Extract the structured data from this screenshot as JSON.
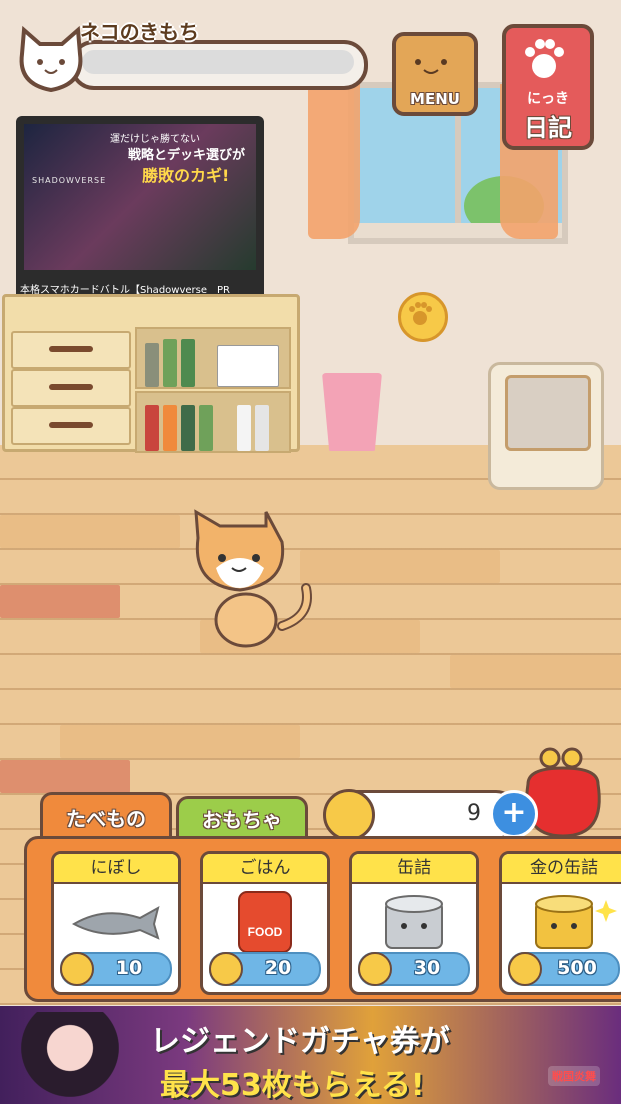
{
  "status": {
    "mood_label": "ネコのきもち",
    "menu_label": "MENU",
    "diary_small": "にっき",
    "diary_big": "日記"
  },
  "tv_ad": {
    "line1": "運だけじゃ勝てない",
    "line2": "戦略とデッキ選びが",
    "line3": "勝敗のカギ!",
    "brand": "SHADOWVERSE",
    "caption": "本格スマホカードバトル【Shadowverse　PR"
  },
  "tabs": {
    "food": "たべもの",
    "toys": "おもちゃ"
  },
  "wallet": {
    "coins": "9",
    "plus": "+"
  },
  "shop_items": [
    {
      "name": "にぼし",
      "price": "10",
      "icon": "dried-fish-icon"
    },
    {
      "name": "ごはん",
      "price": "20",
      "icon": "food-bag-icon",
      "pic_text": "FOOD"
    },
    {
      "name": "缶詰",
      "price": "30",
      "icon": "cat-can-icon"
    },
    {
      "name": "金の缶詰",
      "price": "500",
      "icon": "gold-can-icon"
    }
  ],
  "banner": {
    "line1": "レジェンドガチャ券が",
    "line2": "最大53枚もらえる!",
    "badge": "戦国炎舞"
  },
  "colors": {
    "panel_orange": "#f08a3c",
    "tab_green": "#9ccd4a",
    "item_header_yellow": "#ffe24a",
    "price_blue": "#6fb6e6",
    "outline_brown": "#6b4a3a"
  }
}
